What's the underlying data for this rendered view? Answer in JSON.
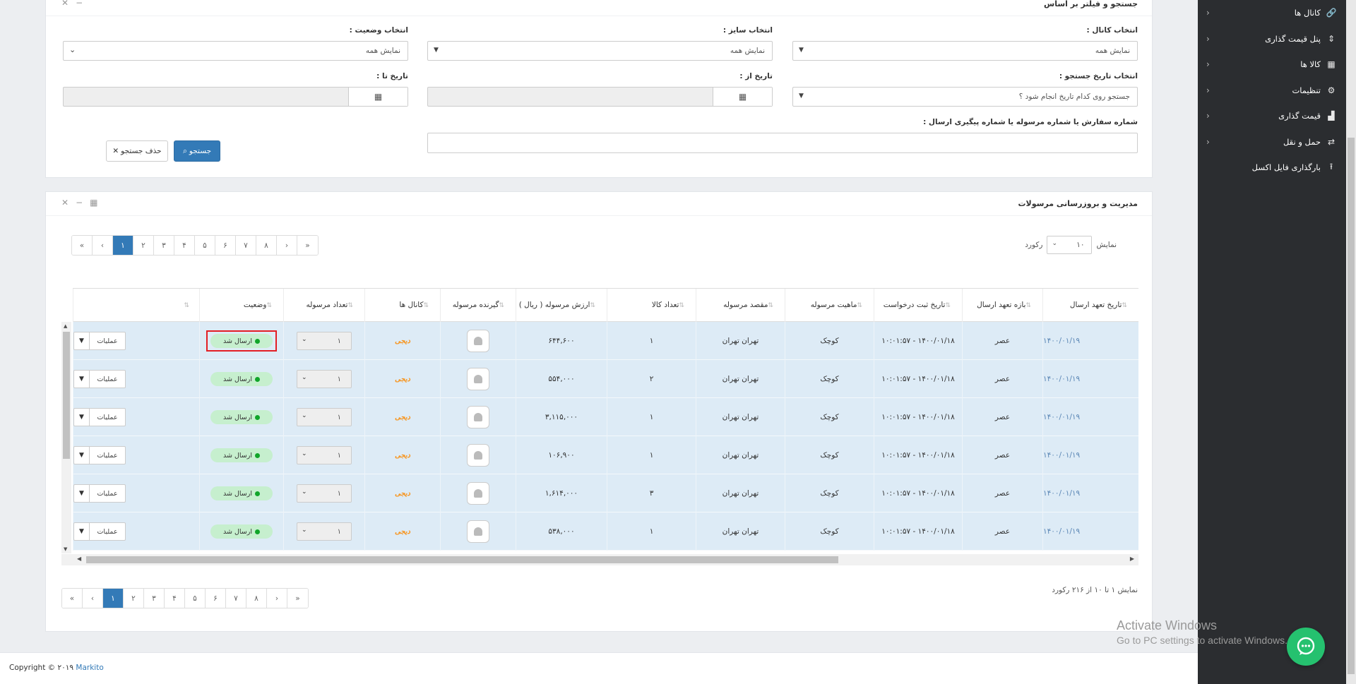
{
  "sidebar": {
    "items": [
      {
        "label": "کانال ها",
        "icon": "link-icon",
        "glyph": "🔗"
      },
      {
        "label": "پنل قیمت گذاری",
        "icon": "sort-icon",
        "glyph": "⇕"
      },
      {
        "label": "کالا ها",
        "icon": "cubes-icon",
        "glyph": "▦"
      },
      {
        "label": "تنظیمات",
        "icon": "gear-icon",
        "glyph": "⚙"
      },
      {
        "label": "قیمت گذاری",
        "icon": "chart-icon",
        "glyph": "▟"
      },
      {
        "label": "حمل و نقل",
        "icon": "exchange-icon",
        "glyph": "⇄"
      },
      {
        "label": "بارگذاری فایل اکسل",
        "icon": "upload-icon",
        "glyph": "⭱"
      }
    ]
  },
  "filter_panel": {
    "title": "جستجو و فیلتر بر اساس",
    "channel_label": "انتخاب کانال :",
    "channel_value": "نمایش همه",
    "size_label": "انتخاب سایز :",
    "size_value": "نمایش همه",
    "status_label": "انتخاب وضعیت :",
    "status_value": "نمایش همه",
    "date_type_label": "انتخاب تاریخ جستجو :",
    "date_type_value": "جستجو روی کدام تاریخ انجام شود ؟",
    "date_from_label": "تاریخ از :",
    "date_to_label": "تاریخ تا :",
    "order_label": "شماره سفارش یا شماره مرسوله یا شماره پیگیری ارسال :",
    "search_button": "جستجو",
    "clear_button": "حذف جستجو"
  },
  "table_panel": {
    "title": "مدیریت و بروزرسانی مرسولات",
    "show_label": "نمایش",
    "page_size": "۱۰",
    "records_label": "رکورد",
    "pager": [
      "«",
      "‹",
      "۱",
      "۲",
      "۳",
      "۴",
      "۵",
      "۶",
      "۷",
      "۸",
      "›",
      "»"
    ],
    "info": "نمایش ۱ تا ۱۰ از ۲۱۶ رکورد",
    "columns": {
      "send_date": "تاریخ تعهد ارسال",
      "send_slot": "بازه تعهد ارسال",
      "request_date": "تاریخ ثبت درخواست",
      "nature": "ماهیت مرسوله",
      "destination": "مقصد مرسوله",
      "item_count": "تعداد کالا",
      "value": "ارزش مرسوله ( ریال )",
      "receiver": "گیرنده مرسوله",
      "channels": "کانال ها",
      "parcel_count": "تعداد مرسوله",
      "status": "وضعیت"
    },
    "rows": [
      {
        "send_date": "۱۴۰۰/۰۱/۱۹",
        "send_slot": "عصر",
        "request_date": "۱۴۰۰/۰۱/۱۸ - ۱۰:۰۱:۵۷",
        "nature": "کوچک",
        "destination": "تهران تهران",
        "item_count": "۱",
        "value": "۶۴۴,۶۰۰",
        "channel_logo": "دیجی",
        "parcel_count": "۱",
        "status": "ارسال شد",
        "ops": "عملیات"
      },
      {
        "send_date": "۱۴۰۰/۰۱/۱۹",
        "send_slot": "عصر",
        "request_date": "۱۴۰۰/۰۱/۱۸ - ۱۰:۰۱:۵۷",
        "nature": "کوچک",
        "destination": "تهران تهران",
        "item_count": "۲",
        "value": "۵۵۴,۰۰۰",
        "channel_logo": "دیجی",
        "parcel_count": "۱",
        "status": "ارسال شد",
        "ops": "عملیات"
      },
      {
        "send_date": "۱۴۰۰/۰۱/۱۹",
        "send_slot": "عصر",
        "request_date": "۱۴۰۰/۰۱/۱۸ - ۱۰:۰۱:۵۷",
        "nature": "کوچک",
        "destination": "تهران تهران",
        "item_count": "۱",
        "value": "۳,۱۱۵,۰۰۰",
        "channel_logo": "دیجی",
        "parcel_count": "۱",
        "status": "ارسال شد",
        "ops": "عملیات"
      },
      {
        "send_date": "۱۴۰۰/۰۱/۱۹",
        "send_slot": "عصر",
        "request_date": "۱۴۰۰/۰۱/۱۸ - ۱۰:۰۱:۵۷",
        "nature": "کوچک",
        "destination": "تهران تهران",
        "item_count": "۱",
        "value": "۱۰۶,۹۰۰",
        "channel_logo": "دیجی",
        "parcel_count": "۱",
        "status": "ارسال شد",
        "ops": "عملیات"
      },
      {
        "send_date": "۱۴۰۰/۰۱/۱۹",
        "send_slot": "عصر",
        "request_date": "۱۴۰۰/۰۱/۱۸ - ۱۰:۰۱:۵۷",
        "nature": "کوچک",
        "destination": "تهران تهران",
        "item_count": "۳",
        "value": "۱,۶۱۴,۰۰۰",
        "channel_logo": "دیجی",
        "parcel_count": "۱",
        "status": "ارسال شد",
        "ops": "عملیات"
      },
      {
        "send_date": "۱۴۰۰/۰۱/۱۹",
        "send_slot": "عصر",
        "request_date": "۱۴۰۰/۰۱/۱۸ - ۱۰:۰۱:۵۷",
        "nature": "کوچک",
        "destination": "تهران تهران",
        "item_count": "۱",
        "value": "۵۳۸,۰۰۰",
        "channel_logo": "دیجی",
        "parcel_count": "۱",
        "status": "ارسال شد",
        "ops": "عملیات"
      }
    ]
  },
  "footer": {
    "copyright": "Copyright © ۲۰۱۹",
    "brand": "Markito"
  },
  "watermark": {
    "line1": "Activate Windows",
    "line2": "Go to PC settings to activate Windows."
  },
  "colors": {
    "primary": "#337ab7",
    "sidebar": "#2b2d30",
    "row_bg": "#ddebf6",
    "status_green": "#11a52a",
    "highlight": "#e31e24",
    "chat": "#25c16f"
  }
}
